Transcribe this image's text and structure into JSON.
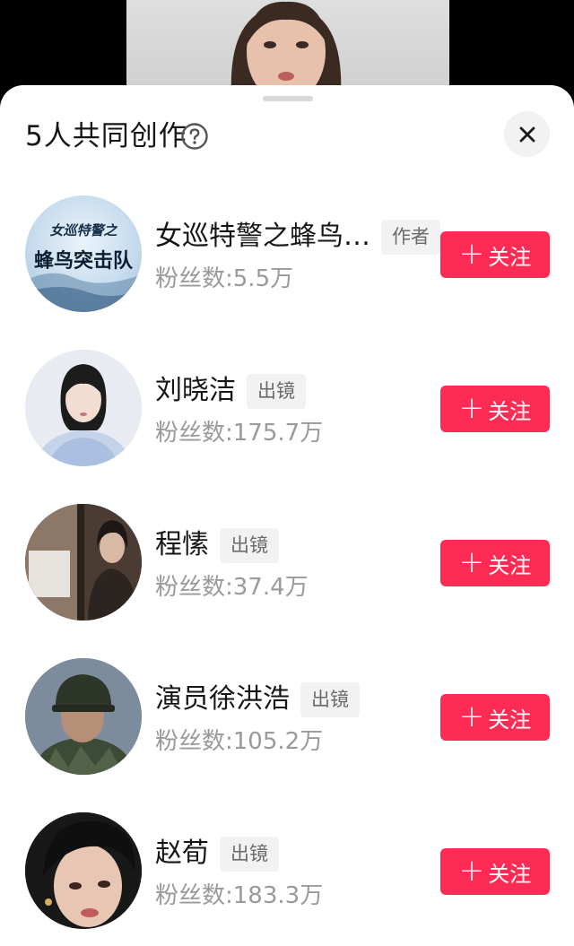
{
  "sheet": {
    "title": "5人共同创作"
  },
  "creators": [
    {
      "name": "女巡特警之蜂鸟…",
      "tag": "作者",
      "fans": "粉丝数:5.5万",
      "follow_label": "关注",
      "avatar_text_top": "女巡特警之",
      "avatar_text_bottom": "蜂鸟突击队"
    },
    {
      "name": "刘晓洁",
      "tag": "出镜",
      "fans": "粉丝数:175.7万",
      "follow_label": "关注"
    },
    {
      "name": "程愫",
      "tag": "出镜",
      "fans": "粉丝数:37.4万",
      "follow_label": "关注"
    },
    {
      "name": "演员徐洪浩",
      "tag": "出镜",
      "fans": "粉丝数:105.2万",
      "follow_label": "关注"
    },
    {
      "name": "赵荀",
      "tag": "出镜",
      "fans": "粉丝数:183.3万",
      "follow_label": "关注"
    }
  ],
  "colors": {
    "accent": "#fe2c55",
    "tag_bg": "#f2f2f2"
  },
  "icons": {
    "help": "question-circle-icon",
    "close": "close-icon",
    "follow": "plus-icon"
  }
}
